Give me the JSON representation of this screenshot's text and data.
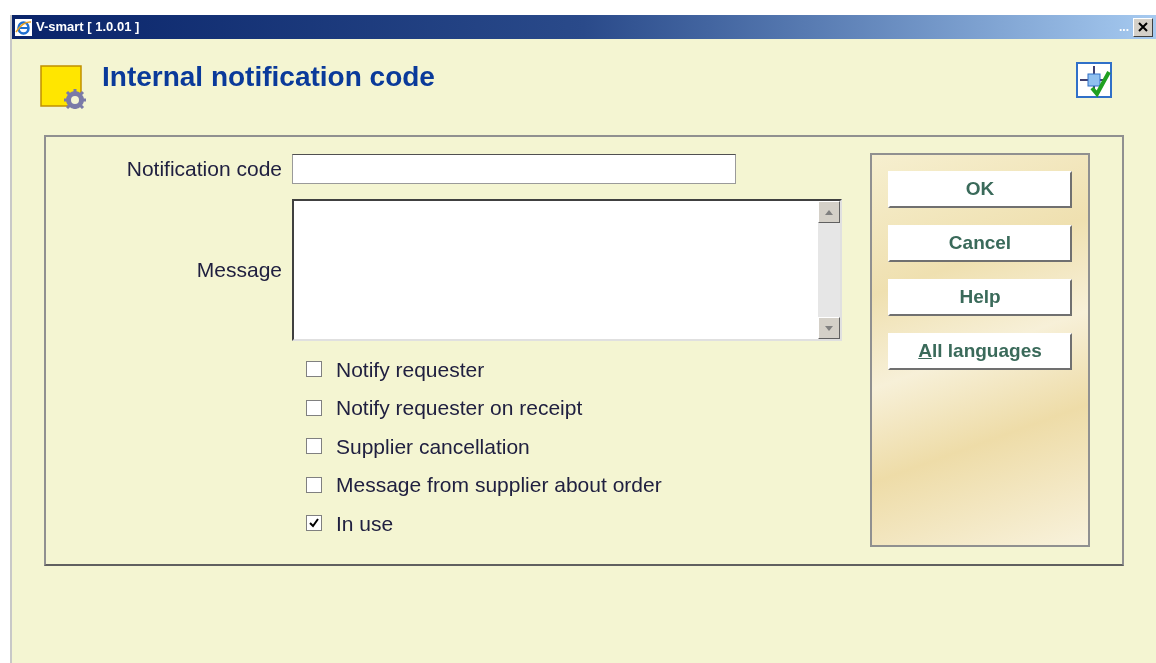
{
  "window": {
    "title": "V-smart [ 1.0.01 ]",
    "ellipsis": "..."
  },
  "heading": "Internal notification code",
  "form": {
    "code_label": "Notification code",
    "message_label": "Message",
    "options": [
      {
        "label": "Notify requester",
        "checked": false
      },
      {
        "label": "Notify requester on receipt",
        "checked": false
      },
      {
        "label": "Supplier cancellation",
        "checked": false
      },
      {
        "label": "Message from supplier about order",
        "checked": false
      },
      {
        "label": "In use",
        "checked": true
      }
    ]
  },
  "buttons": [
    {
      "label": "OK",
      "mnemonic": false
    },
    {
      "label": "Cancel",
      "mnemonic": false
    },
    {
      "label": "Help",
      "mnemonic": false
    },
    {
      "label": "All languages",
      "mnemonic": true
    }
  ]
}
